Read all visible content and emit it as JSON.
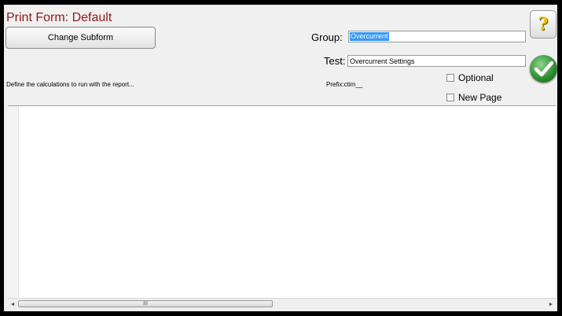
{
  "header": {
    "title": "Print Form: Default",
    "change_subform_label": "Change Subform"
  },
  "form": {
    "group_label": "Group:",
    "group_value": "Overcurrent",
    "test_label": "Test:",
    "test_value": "Overcurrent Settings",
    "description": "Define the calculations to run with the report...",
    "prefix": "Prefix:ctim__"
  },
  "options": {
    "optional_label": "Optional",
    "optional_checked": false,
    "new_page_label": "New Page",
    "new_page_checked": false
  },
  "actions": {
    "help_glyph": "?",
    "help_icon": "question-mark-icon",
    "ok_icon": "green-checkmark-icon"
  },
  "editor": {
    "content": ""
  },
  "scrollbar": {
    "left_arrow": "◄",
    "right_arrow": "►",
    "thumb_grip": "III"
  },
  "colors": {
    "title": "#8b1a1a",
    "selection": "#3399ff",
    "ok_green": "#2c8a2c",
    "help_yellow": "#e8c200"
  }
}
